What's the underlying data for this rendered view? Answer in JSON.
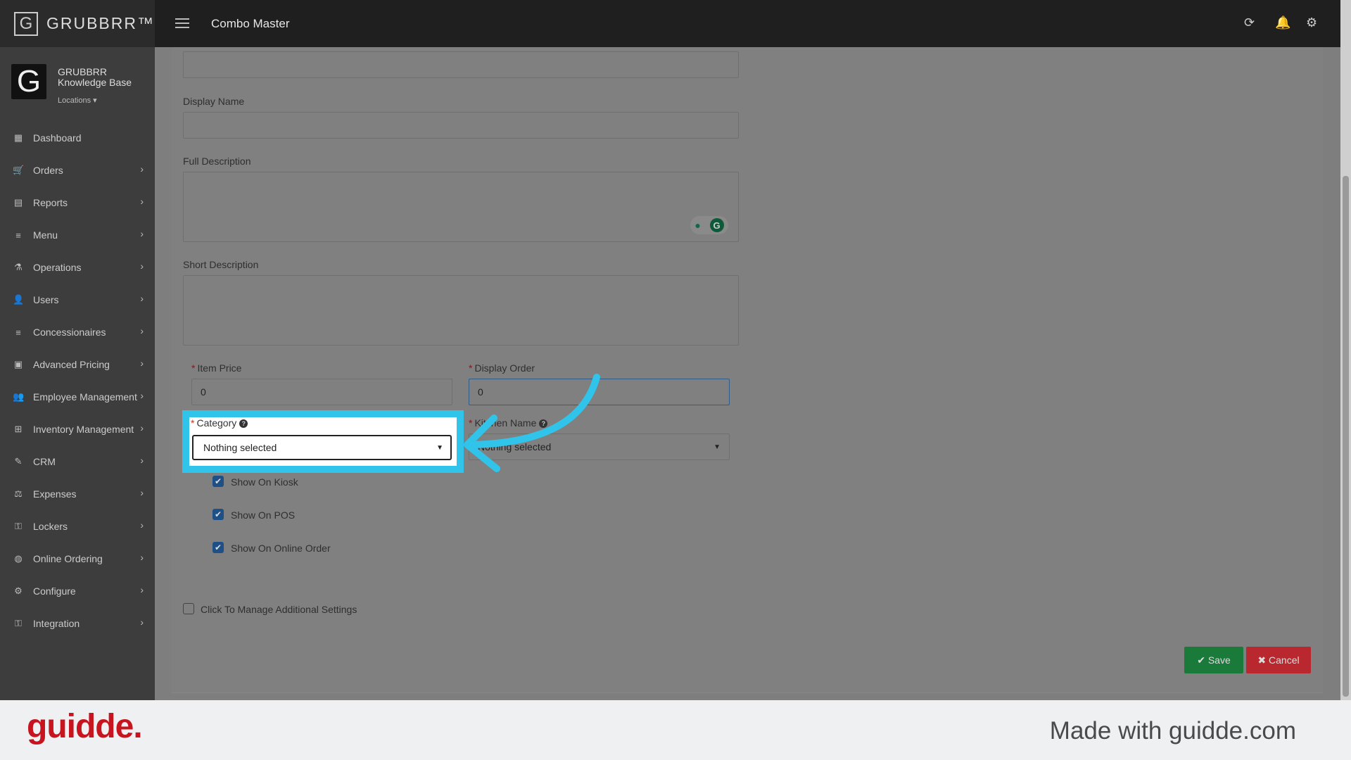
{
  "topbar": {
    "brand": "GRUBBRR™",
    "logo_letter": "G",
    "page_title": "Combo Master",
    "icons": [
      "refresh-icon",
      "bell-icon",
      "gear-icon"
    ]
  },
  "sidebar": {
    "profile": {
      "logo_letter": "G",
      "name": "GRUBBRR Knowledge Base",
      "locations_label": "Locations"
    },
    "items": [
      {
        "label": "Dashboard",
        "icon": "dashboard-icon",
        "glyph": "▦",
        "has_children": false
      },
      {
        "label": "Orders",
        "icon": "cart-icon",
        "glyph": "🛒",
        "has_children": true
      },
      {
        "label": "Reports",
        "icon": "report-icon",
        "glyph": "▤",
        "has_children": true
      },
      {
        "label": "Menu",
        "icon": "menu-list-icon",
        "glyph": "≡",
        "has_children": true
      },
      {
        "label": "Operations",
        "icon": "flask-icon",
        "glyph": "⚗",
        "has_children": true
      },
      {
        "label": "Users",
        "icon": "users-icon",
        "glyph": "👤",
        "has_children": true
      },
      {
        "label": "Concessionaires",
        "icon": "list-icon",
        "glyph": "≡",
        "has_children": true
      },
      {
        "label": "Advanced Pricing",
        "icon": "money-icon",
        "glyph": "▣",
        "has_children": true
      },
      {
        "label": "Employee Management",
        "icon": "employees-icon",
        "glyph": "👥",
        "has_children": true
      },
      {
        "label": "Inventory Management",
        "icon": "sitemap-icon",
        "glyph": "⊞",
        "has_children": true
      },
      {
        "label": "CRM",
        "icon": "crm-icon",
        "glyph": "✎",
        "has_children": true
      },
      {
        "label": "Expenses",
        "icon": "balance-icon",
        "glyph": "⚖",
        "has_children": true
      },
      {
        "label": "Lockers",
        "icon": "locker-icon",
        "glyph": "⚿",
        "has_children": true
      },
      {
        "label": "Online Ordering",
        "icon": "globe-icon",
        "glyph": "◍",
        "has_children": true
      },
      {
        "label": "Configure",
        "icon": "cog-icon",
        "glyph": "⚙",
        "has_children": true
      },
      {
        "label": "Integration",
        "icon": "plug-icon",
        "glyph": "⚿",
        "has_children": true
      }
    ]
  },
  "form": {
    "display_name_label": "Display Name",
    "display_name_value": "",
    "full_description_label": "Full Description",
    "short_description_label": "Short Description",
    "item_price_label": "Item Price",
    "item_price_value": "0",
    "display_order_label": "Display Order",
    "display_order_value": "0",
    "category_label": "Category",
    "category_value": "Nothing selected",
    "kitchen_name_label": "Kitchen Name",
    "kitchen_name_value": "Nothing selected",
    "checkboxes": [
      {
        "label": "Show On Kiosk",
        "checked": true
      },
      {
        "label": "Show On POS",
        "checked": true
      },
      {
        "label": "Show On Online Order",
        "checked": true
      }
    ],
    "additional_settings_label": "Click To Manage Additional Settings",
    "save_label": "Save",
    "cancel_label": "Cancel"
  },
  "colors": {
    "highlight": "#31c4ea",
    "save": "#1a7a3a",
    "cancel": "#b8282e",
    "guidde_red": "#c8141e"
  },
  "footer": {
    "logo": "guidde.",
    "tagline": "Made with guidde.com"
  }
}
